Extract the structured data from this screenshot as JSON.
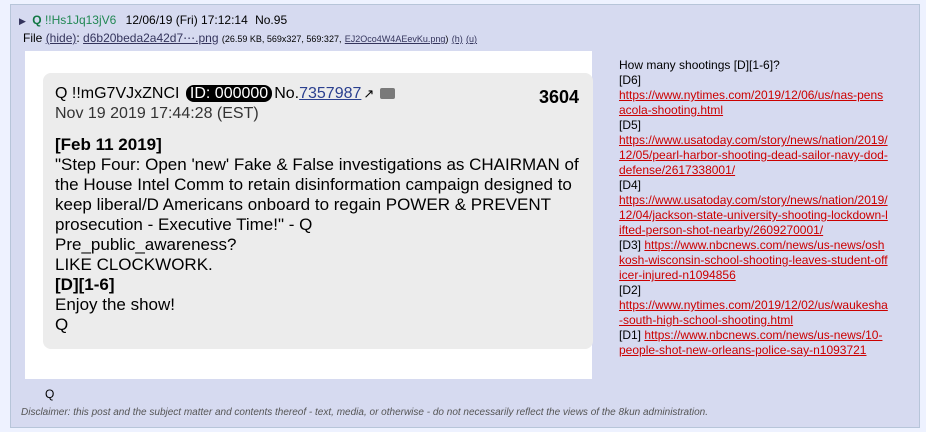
{
  "header": {
    "name": "Q",
    "tripcode": "!!Hs1Jq13jV6",
    "datetime": "12/06/19 (Fri) 17:12:14",
    "post_number": "No.95"
  },
  "file": {
    "prefix": "File",
    "hide_label": "(hide)",
    "filename": "d6b20beda2a42d7⋯.png",
    "meta": "(26.59 KB, 569x327, 569:327,",
    "orig_name": "EJ2Oco4W4AEevKu.png",
    "suffix": ")",
    "h_link": "(h)",
    "u_link": "(u)"
  },
  "embedded": {
    "name": "Q !!mG7VJxZNCI",
    "id_label": "ID: 000000",
    "no_prefix": "No.",
    "no_link": "7357987",
    "date": "Nov 19 2019 17:44:28 (EST)",
    "count": "3604",
    "lines": [
      "[Feb 11 2019]",
      "\"Step Four: Open 'new' Fake & False investigations as CHAIRMAN of the House Intel Comm to retain disinformation campaign designed to keep liberal/D Americans onboard to regain POWER & PREVENT prosecution - Executive Time!\" - Q",
      "Pre_public_awareness?",
      "LIKE CLOCKWORK.",
      "[D][1-6]",
      "Enjoy the show!",
      "Q"
    ]
  },
  "side": {
    "question": "How many shootings [D][1-6]?",
    "d6_label": "[D6]",
    "d6_url": "https://www.nytimes.com/2019/12/06/us/nas-pensacola-shooting.html",
    "d5_label": "[D5]",
    "d5_url": "https://www.usatoday.com/story/news/nation/2019/12/05/pearl-harbor-shooting-dead-sailor-navy-dod-defense/2617338001/",
    "d4_label": "[D4]",
    "d4_url": "https://www.usatoday.com/story/news/nation/2019/12/04/jackson-state-university-shooting-lockdown-lifted-person-shot-nearby/2609270001/",
    "d3_label": "[D3]",
    "d3_url": "https://www.nbcnews.com/news/us-news/oshkosh-wisconsin-school-shooting-leaves-student-officer-injured-n1094856",
    "d2_label": "[D2]",
    "d2_url": "https://www.nytimes.com/2019/12/02/us/waukesha-south-high-school-shooting.html",
    "d1_label": "[D1]",
    "d1_url": "https://www.nbcnews.com/news/us-news/10-people-shot-new-orleans-police-say-n1093721"
  },
  "footer_q": "Q",
  "disclaimer": "Disclaimer: this post and the subject matter and contents thereof - text, media, or otherwise - do not necessarily reflect the views of the 8kun administration."
}
